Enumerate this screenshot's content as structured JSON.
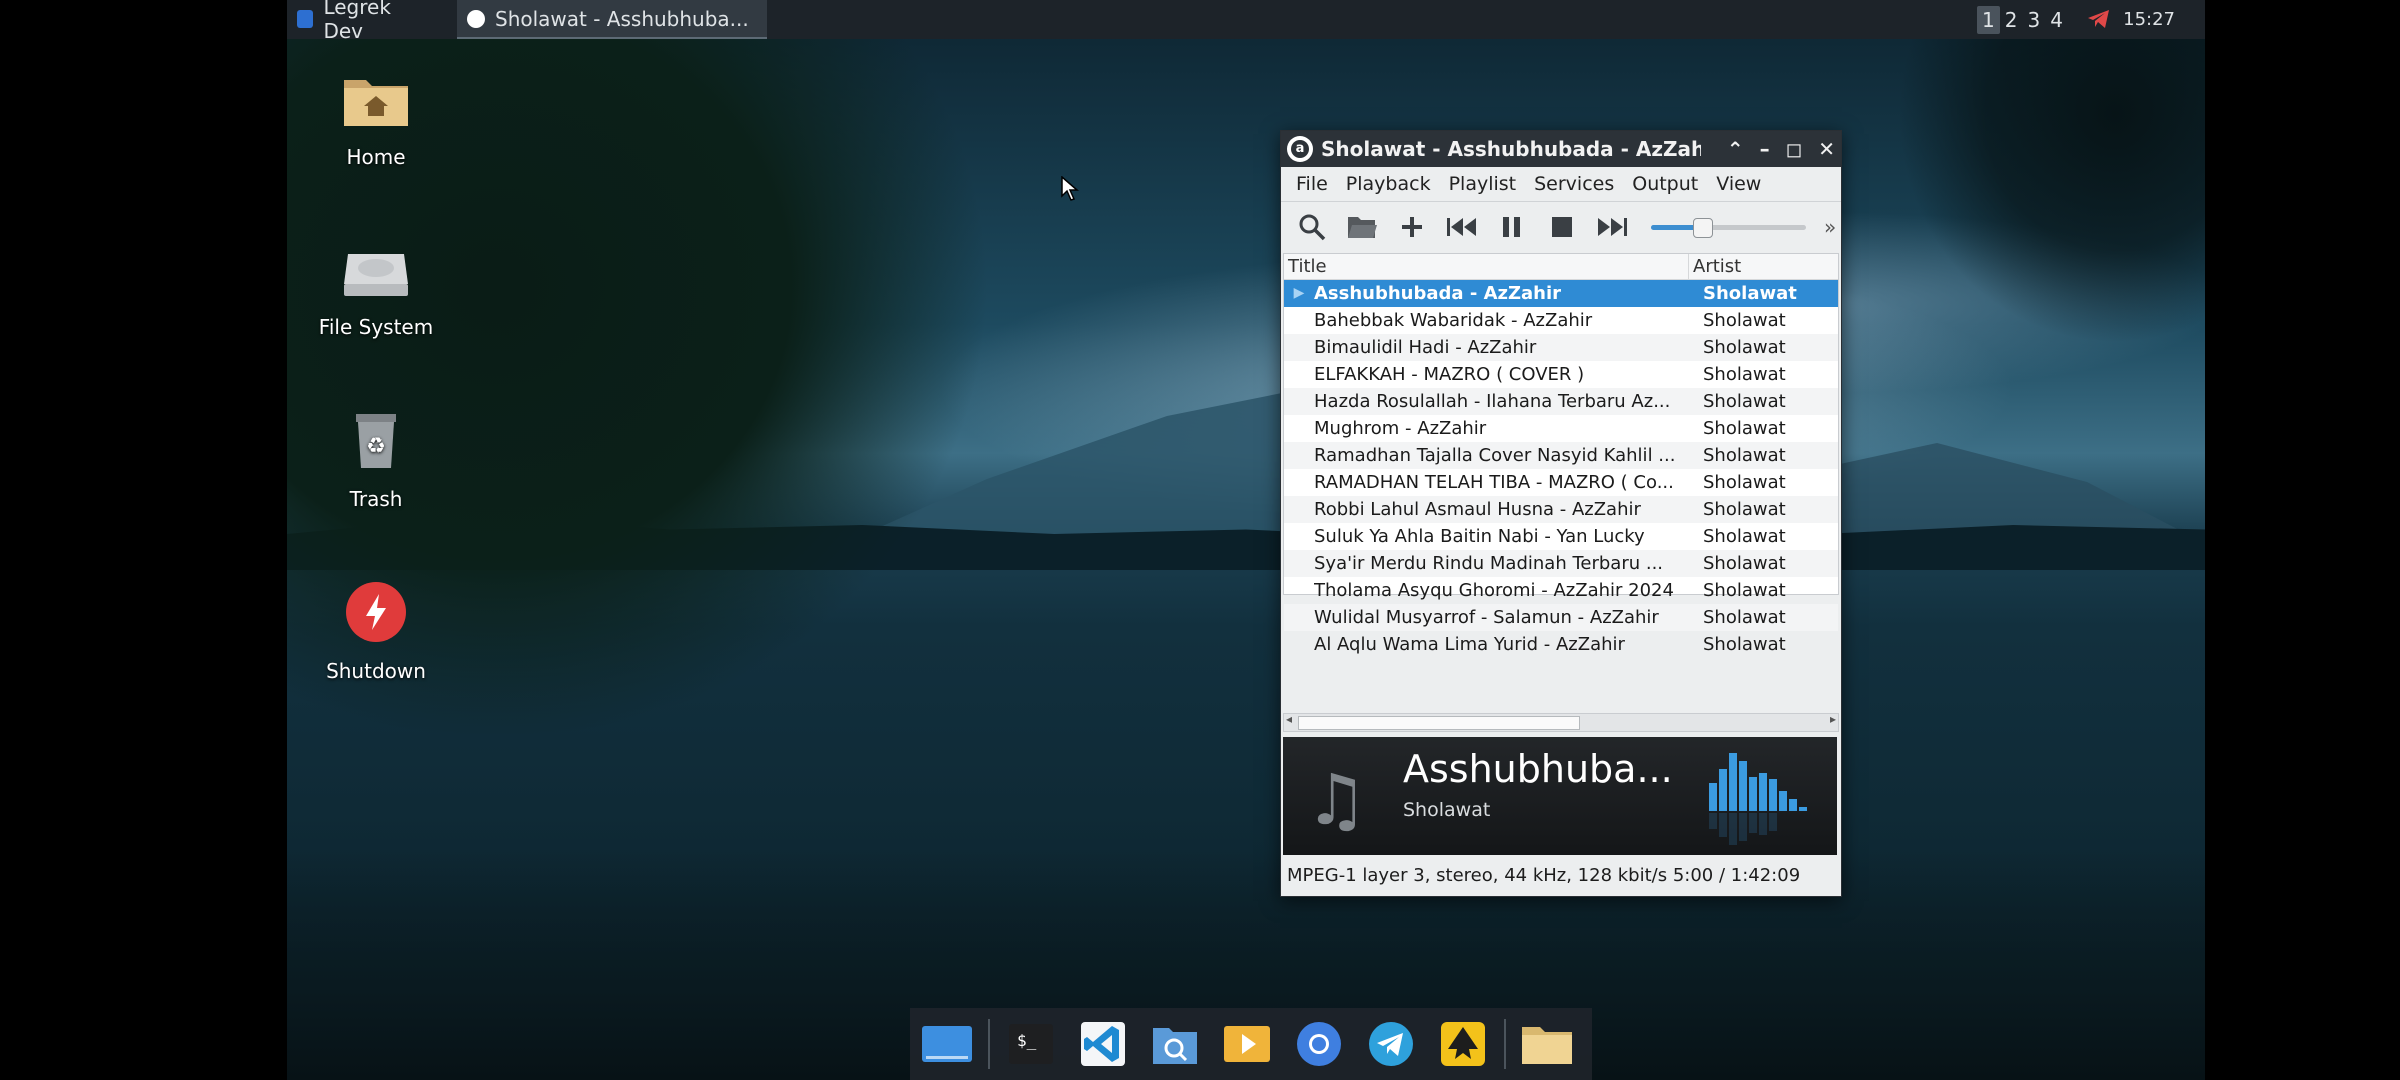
{
  "topbar": {
    "tasks": [
      {
        "label": "Legrek Dev",
        "icon": "app-icon"
      },
      {
        "label": "Sholawat - Asshubhuba...",
        "icon": "audacious-icon"
      }
    ],
    "workspaces": [
      "1",
      "2",
      "3",
      "4"
    ],
    "active_workspace": "1",
    "clock": "15:27"
  },
  "desktop_icons": [
    {
      "label": "Home",
      "icon": "home-folder-icon"
    },
    {
      "label": "File System",
      "icon": "drive-icon"
    },
    {
      "label": "Trash",
      "icon": "trash-icon"
    },
    {
      "label": "Shutdown",
      "icon": "power-icon"
    }
  ],
  "player": {
    "window_title": "Sholawat - Asshubhubada - AzZahir (",
    "menu": [
      "File",
      "Playback",
      "Playlist",
      "Services",
      "Output",
      "View"
    ],
    "volume_percent": 33,
    "columns": {
      "title": "Title",
      "artist": "Artist"
    },
    "tracks": [
      {
        "title": "Asshubhubada - AzZahir",
        "artist": "Sholawat",
        "playing": true
      },
      {
        "title": "Bahebbak Wabaridak - AzZahir",
        "artist": "Sholawat"
      },
      {
        "title": "Bimaulidil Hadi - AzZahir",
        "artist": "Sholawat"
      },
      {
        "title": "ELFAKKAH - MAZRO ( COVER )",
        "artist": "Sholawat"
      },
      {
        "title": "Hazda Rosulallah - Ilahana  Terbaru Az...",
        "artist": "Sholawat"
      },
      {
        "title": "Mughrom - AzZahir",
        "artist": "Sholawat"
      },
      {
        "title": "Ramadhan Tajalla  Cover Nasyid Kahlil ...",
        "artist": "Sholawat"
      },
      {
        "title": "RAMADHAN TELAH TIBA - MAZRO ( Co...",
        "artist": "Sholawat"
      },
      {
        "title": "Robbi Lahul Asmaul Husna - AzZahir",
        "artist": "Sholawat"
      },
      {
        "title": "Suluk Ya Ahla Baitin Nabi - Yan Lucky",
        "artist": "Sholawat"
      },
      {
        "title": "Sya'ir Merdu  Rindu Madinah  Terbaru ...",
        "artist": "Sholawat"
      },
      {
        "title": "Tholama Asyqu Ghoromi - AzZahir 2024",
        "artist": "Sholawat"
      },
      {
        "title": "Wulidal Musyarrof - Salamun - AzZahir",
        "artist": "Sholawat"
      },
      {
        "title": "Al Aqlu Wama Lima Yurid - AzZahir",
        "artist": "Sholawat"
      }
    ],
    "now_playing": {
      "title": "Asshubhuba...",
      "artist": "Sholawat"
    },
    "status": "MPEG-1 layer 3, stereo, 44 kHz, 128 kbit/s  5:00 / 1:42:09"
  },
  "dock": [
    "show-desktop",
    "terminal",
    "vscode",
    "search",
    "media-player",
    "chromium",
    "telegram",
    "inkscape",
    "file-manager"
  ],
  "colors": {
    "selection": "#2f8bd4",
    "panel": "#1d2329"
  }
}
